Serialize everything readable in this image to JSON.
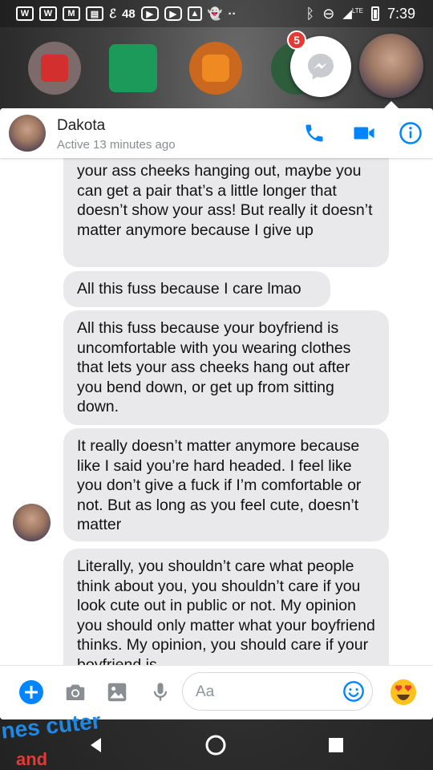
{
  "status_bar": {
    "icons": [
      "wattpad-icon",
      "wattpad-icon",
      "gmail-icon",
      "book-icon",
      "e-icon",
      "youtube-icon",
      "youtube-icon",
      "image-icon",
      "ghost-icon",
      "more-dots-icon",
      "bluetooth-icon",
      "do-not-disturb-icon",
      "signal-icon",
      "battery-icon"
    ],
    "number": "48",
    "network": "LTE",
    "time": "7:39"
  },
  "launcher": {
    "apps": [
      "cloud-app-icon",
      "hangouts-app-icon",
      "wattpad-app-icon",
      "green-app-icon"
    ]
  },
  "chat_heads": {
    "messenger_badge": "5"
  },
  "header": {
    "name": "Dakota",
    "status": "Active 13 minutes ago"
  },
  "messages": [
    {
      "text": "your ass cheeks hanging out, maybe you can get a pair that’s a little longer that doesn’t show your ass! But really it doesn’t matter anymore because I give up"
    },
    {
      "text": "All this fuss because I care lmao"
    },
    {
      "text": "All this fuss because your boyfriend is uncomfortable with you wearing clothes that lets your ass cheeks hang out after you bend down, or get up from sitting down."
    },
    {
      "text": "It really doesn’t matter anymore because like I said you’re hard headed. I feel like you don’t give a fuck if I’m comfortable or not. But as long as you feel cute, doesn’t matter"
    },
    {
      "text": "Literally, you shouldn’t care what people think about you, you shouldn’t care if you look cute out in public or not. My opinion you should only matter what your boyfriend thinks. My opinion, you should care if your boyfriend is"
    }
  ],
  "composer": {
    "placeholder": "Aa"
  },
  "wallpaper_text": {
    "line1": "nes cuter",
    "line2": "and"
  },
  "colors": {
    "accent": "#0084ff",
    "bubble": "#e9e9eb",
    "badge": "#e53935"
  }
}
